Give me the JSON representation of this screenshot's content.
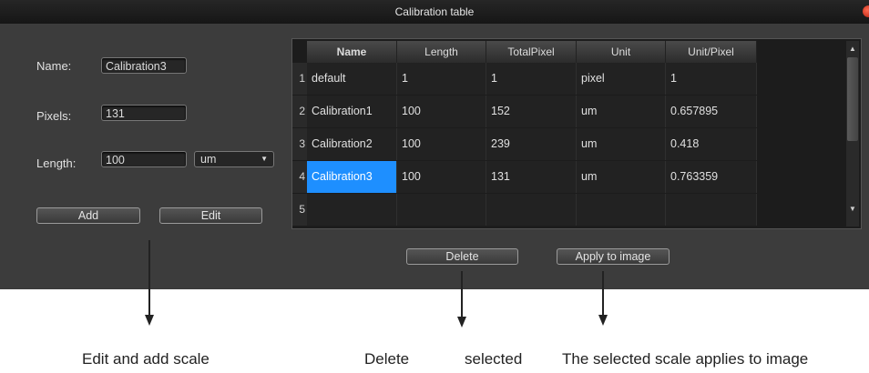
{
  "window": {
    "title": "Calibration table"
  },
  "form": {
    "name_label": "Name:",
    "name_value": "Calibration3",
    "pixels_label": "Pixels:",
    "pixels_value": "131",
    "length_label": "Length:",
    "length_value": "100",
    "unit_value": "um",
    "add_label": "Add",
    "edit_label": "Edit"
  },
  "table": {
    "headers": [
      "Name",
      "Length",
      "TotalPixel",
      "Unit",
      "Unit/Pixel"
    ],
    "row_numbers": [
      "1",
      "2",
      "3",
      "4",
      "5"
    ],
    "rows": [
      [
        "default",
        "1",
        "1",
        "pixel",
        "1"
      ],
      [
        "Calibration1",
        "100",
        "152",
        "um",
        "0.657895"
      ],
      [
        "Calibration2",
        "100",
        "239",
        "um",
        "0.418"
      ],
      [
        "Calibration3",
        "100",
        "131",
        "um",
        "0.763359"
      ],
      [
        "",
        "",
        "",
        "",
        ""
      ]
    ],
    "selected_row": 4
  },
  "actions": {
    "delete_label": "Delete",
    "apply_label": "Apply to image"
  },
  "captions": {
    "edit_add": "Edit and add scale",
    "delete": "Delete",
    "selected": "selected",
    "applies": "The selected scale applies to image"
  }
}
